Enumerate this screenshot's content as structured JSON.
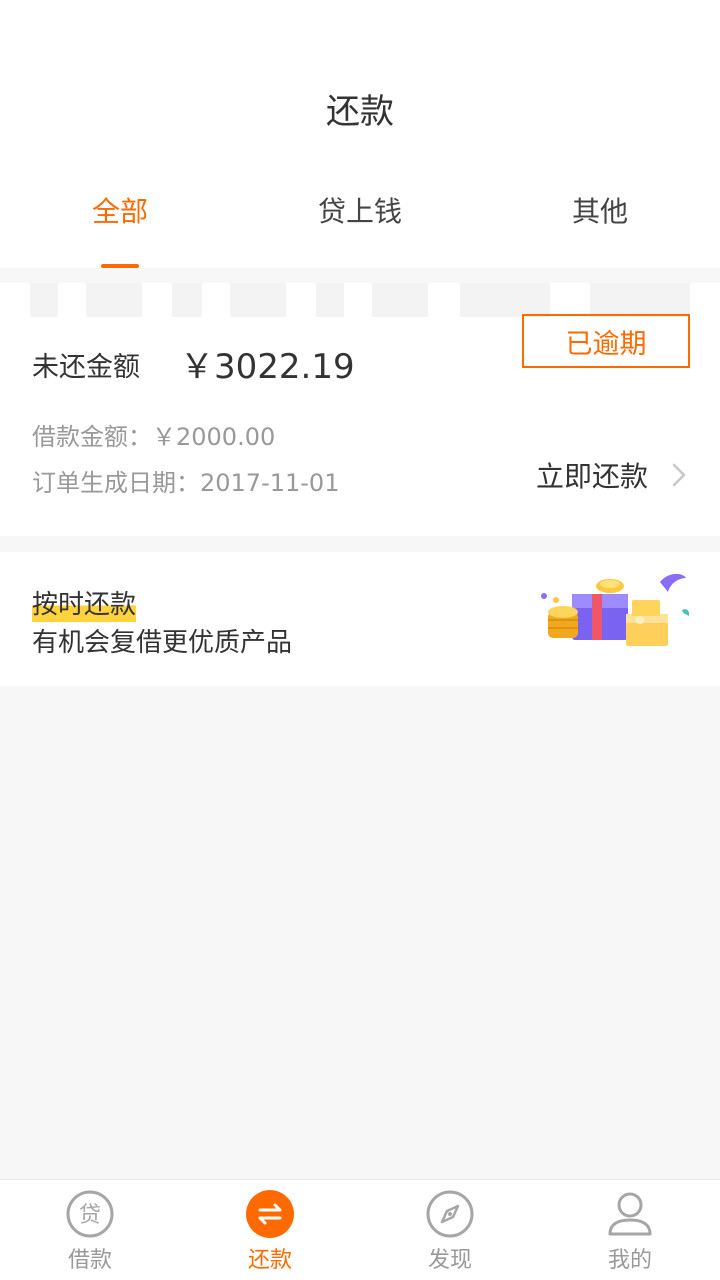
{
  "header": {
    "title": "还款",
    "tabs": [
      {
        "label": "全部",
        "active": true
      },
      {
        "label": "贷上钱",
        "active": false
      },
      {
        "label": "其他",
        "active": false
      }
    ]
  },
  "loan_card": {
    "status_badge": "已逾期",
    "outstanding_label": "未还金额",
    "outstanding_value": "￥3022.19",
    "loan_amount": "借款金额：￥2000.00",
    "order_date": "订单生成日期：2017-11-01",
    "repay_action": "立即还款"
  },
  "promo": {
    "title": "按时还款",
    "subtitle": "有机会复借更优质产品",
    "icon": "gift-box-coins-icon"
  },
  "bottom_nav": {
    "items": [
      {
        "label": "借款",
        "icon": "loan-icon",
        "active": false
      },
      {
        "label": "还款",
        "icon": "repay-icon",
        "active": true
      },
      {
        "label": "发现",
        "icon": "compass-icon",
        "active": false
      },
      {
        "label": "我的",
        "icon": "person-icon",
        "active": false
      }
    ]
  },
  "colors": {
    "accent": "#ff6a00",
    "highlight": "#ffd33d",
    "muted_text": "#999999",
    "background": "#f7f7f7"
  }
}
